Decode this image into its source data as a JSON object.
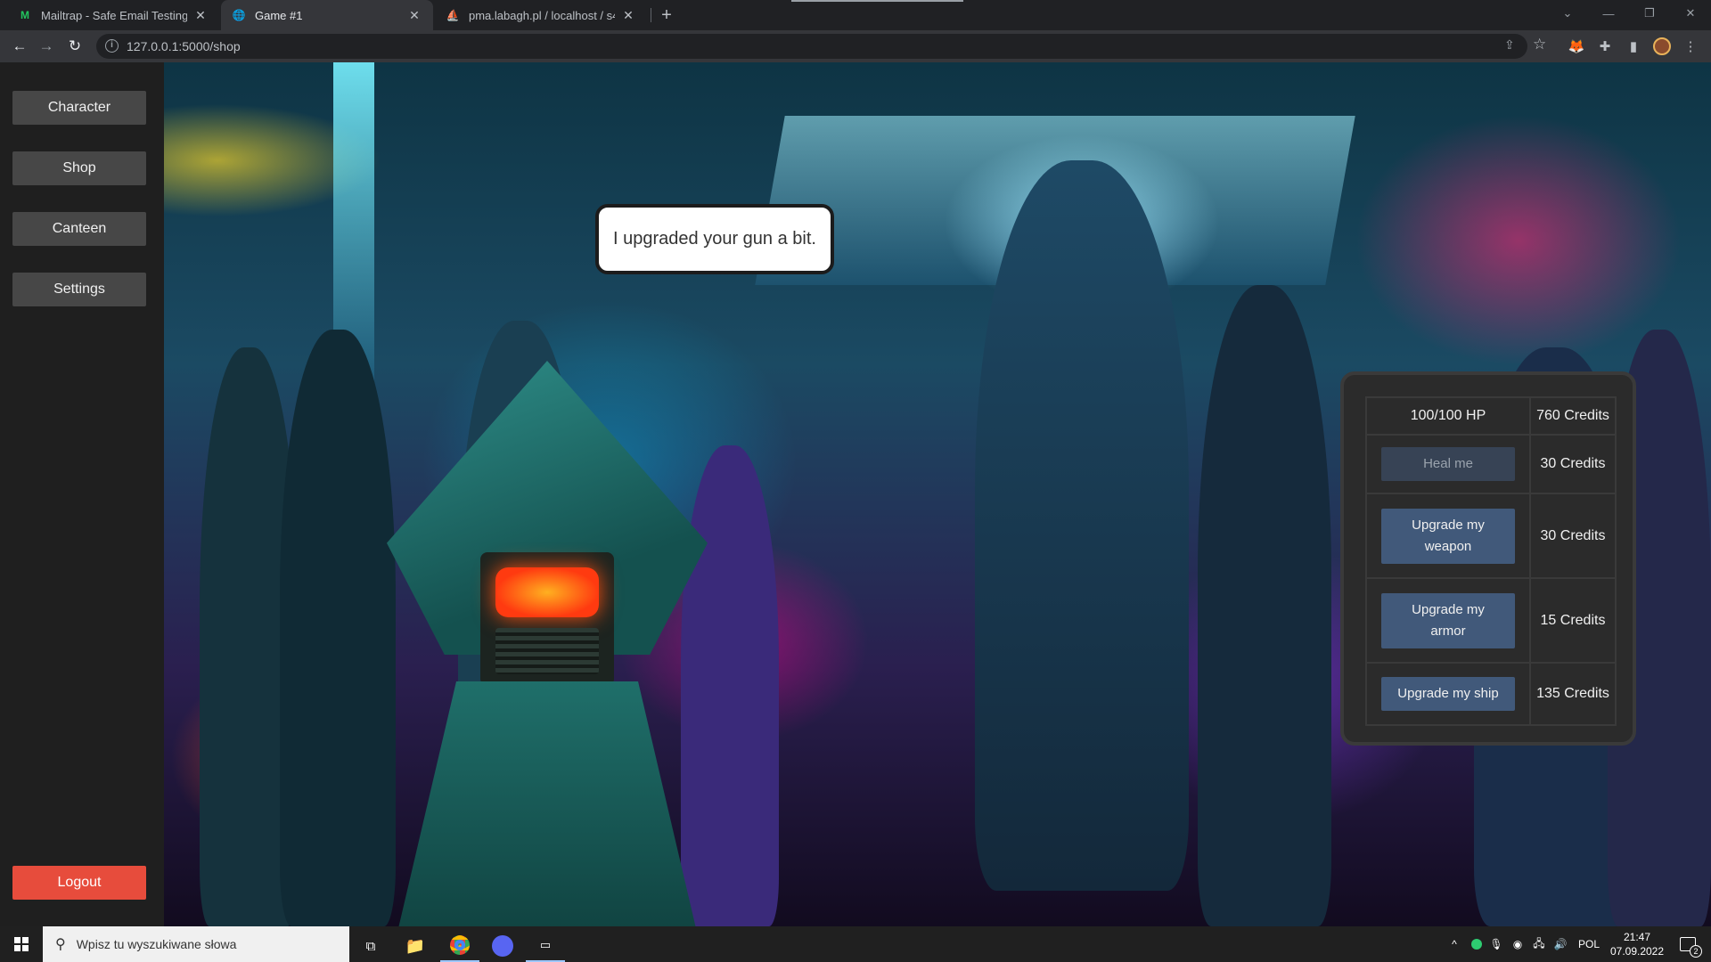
{
  "browser": {
    "tabs": [
      {
        "title": "Mailtrap - Safe Email Testing",
        "icon": "mailtrap-icon"
      },
      {
        "title": "Game #1",
        "icon": "globe-icon"
      },
      {
        "title": "pma.labagh.pl / localhost / s405",
        "icon": "phpmyadmin-icon"
      }
    ],
    "url": "127.0.0.1:5000/shop"
  },
  "sidebar": {
    "items": [
      {
        "label": "Character"
      },
      {
        "label": "Shop"
      },
      {
        "label": "Canteen"
      },
      {
        "label": "Settings"
      }
    ],
    "logout_label": "Logout"
  },
  "npc": {
    "speech": "I upgraded your gun a bit."
  },
  "shop": {
    "hp": "100/100 HP",
    "credits": "760 Credits",
    "items": [
      {
        "label": "Heal me",
        "price": "30 Credits",
        "enabled": false
      },
      {
        "label": "Upgrade my weapon",
        "price": "30 Credits",
        "enabled": true
      },
      {
        "label": "Upgrade my armor",
        "price": "15 Credits",
        "enabled": true
      },
      {
        "label": "Upgrade my ship",
        "price": "135 Credits",
        "enabled": true
      }
    ]
  },
  "taskbar": {
    "search_placeholder": "Wpisz tu wyszukiwane słowa",
    "language": "POL",
    "time": "21:47",
    "date": "07.09.2022",
    "notification_count": "2"
  },
  "colors": {
    "sidebar_button": "#474747",
    "logout_button": "#e74c3c",
    "shop_button": "#41597a"
  }
}
